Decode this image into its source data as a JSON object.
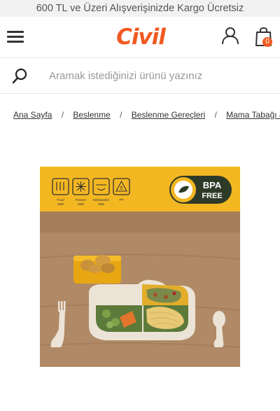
{
  "promo": {
    "text": "600 TL ve Üzeri Alışverişinizde Kargo Ücretsiz"
  },
  "header": {
    "logo_text": "Civil",
    "menu_icon": "hamburger-menu-icon",
    "account_icon": "user-icon",
    "cart_icon": "shopping-bag-icon",
    "cart_count": "0",
    "brand_color": "#f15a22"
  },
  "search": {
    "placeholder": "Aramak istediğinizi ürünü yazınız",
    "value": ""
  },
  "breadcrumb": {
    "items": [
      {
        "label": "Ana Sayfa"
      },
      {
        "label": "Beslenme"
      },
      {
        "label": "Beslenme Gereçleri"
      },
      {
        "label": "Mama Tabağı & Ka"
      }
    ],
    "separator": "/"
  },
  "product_image": {
    "badge_line1": "BPA",
    "badge_line2": "FREE",
    "features": [
      {
        "icon": "food-safe-icon",
        "label_line1": "Food",
        "label_line2": "Safe"
      },
      {
        "icon": "freezer-safe-icon",
        "label_line1": "Freezer",
        "label_line2": "Safe"
      },
      {
        "icon": "dishwasher-safe-icon",
        "label_line1": "Dishwasher",
        "label_line2": "Safe"
      },
      {
        "icon": "pp-recycle-icon",
        "label_line1": "PP",
        "label_line2": ""
      }
    ],
    "pp_number": "5",
    "banner_color": "#f3b722"
  }
}
